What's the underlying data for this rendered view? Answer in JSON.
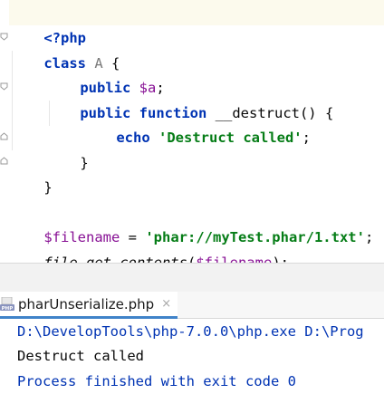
{
  "editor": {
    "lines": {
      "php_open": "<?php",
      "class_kw": "class",
      "class_name": "A",
      "class_brace": " {",
      "public1": "public",
      "prop_var": "$a",
      "prop_semi": ";",
      "public2": "public",
      "function_kw": "function",
      "method_name": " __destruct() {",
      "echo_kw": "echo",
      "echo_str": "'Destruct called'",
      "echo_semi": ";",
      "inner_close": "}",
      "class_close": "}",
      "filename_var": "$filename",
      "assign": " = ",
      "filename_str": "'phar://myTest.phar/1.txt'",
      "assign_semi": ";",
      "fgc_fn": "file_get_contents",
      "fgc_open": "(",
      "fgc_arg": "$filename",
      "fgc_close": ");"
    }
  },
  "run_panel": {
    "tab_label": "pharUnserialize.php",
    "tab_close": "×",
    "tab_icon": "php-file-icon",
    "console": {
      "command": "D:\\DevelopTools\\php-7.0.0\\php.exe D:\\Prog",
      "output": "Destruct called",
      "exit": "Process finished with exit code 0"
    }
  }
}
